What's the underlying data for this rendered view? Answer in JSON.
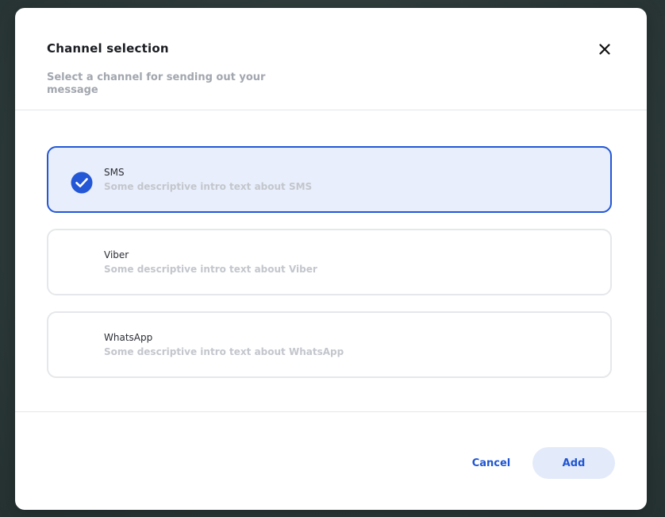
{
  "modal": {
    "title": "Channel selection",
    "subtitle": "Select a channel for sending out your message",
    "close_icon": "close-icon"
  },
  "options": [
    {
      "name": "SMS",
      "description": "Some descriptive intro text about SMS",
      "selected": true
    },
    {
      "name": "Viber",
      "description": "Some descriptive intro text about Viber",
      "selected": false
    },
    {
      "name": "WhatsApp",
      "description": "Some descriptive intro text about WhatsApp",
      "selected": false
    }
  ],
  "footer": {
    "cancel_label": "Cancel",
    "add_label": "Add"
  },
  "colors": {
    "accent": "#2357d6",
    "selected_bg": "#e8eefb",
    "add_button_bg": "#e3eafa",
    "backdrop": "#2f3d3d"
  }
}
